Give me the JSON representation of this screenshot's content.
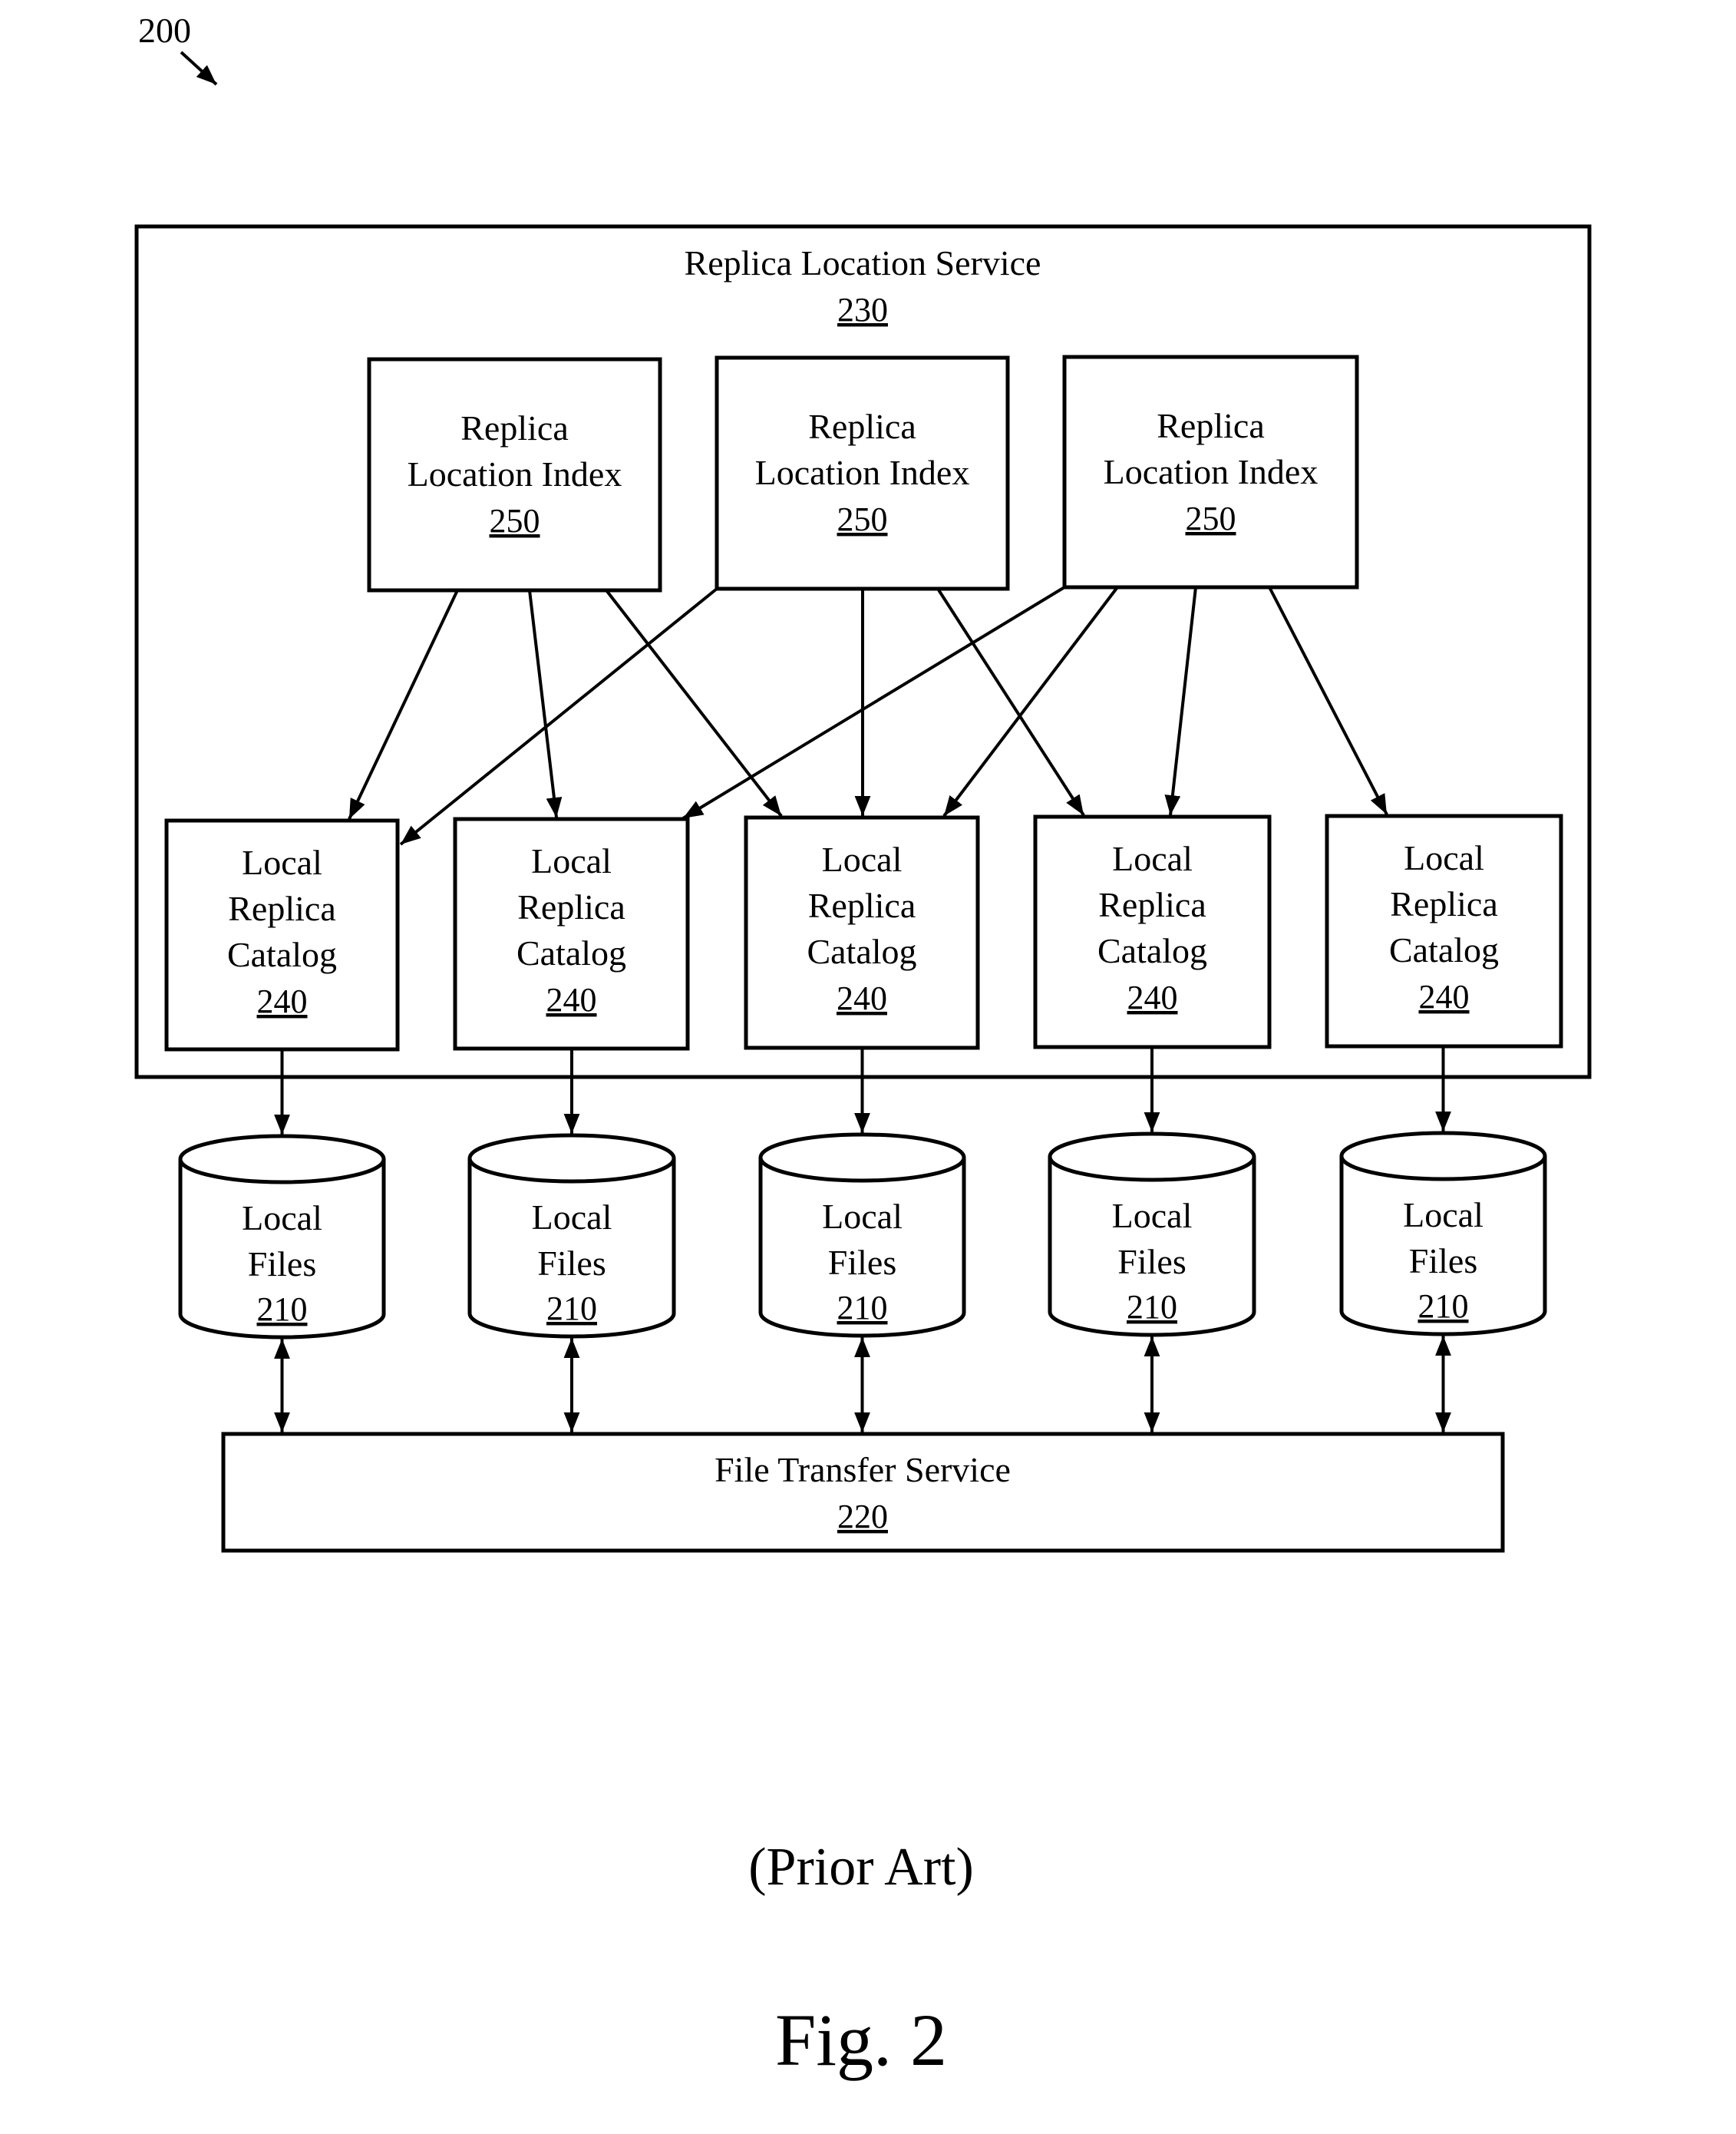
{
  "figure": {
    "ref_number": "200",
    "caption": "(Prior Art)",
    "label": "Fig. 2"
  },
  "replica_location_service": {
    "title": "Replica Location Service",
    "ref": "230"
  },
  "replica_location_indexes": [
    {
      "lines": [
        "Replica",
        "Location Index"
      ],
      "ref": "250"
    },
    {
      "lines": [
        "Replica",
        "Location Index"
      ],
      "ref": "250"
    },
    {
      "lines": [
        "Replica",
        "Location Index"
      ],
      "ref": "250"
    }
  ],
  "local_replica_catalogs": [
    {
      "lines": [
        "Local",
        "Replica",
        "Catalog"
      ],
      "ref": "240"
    },
    {
      "lines": [
        "Local",
        "Replica",
        "Catalog"
      ],
      "ref": "240"
    },
    {
      "lines": [
        "Local",
        "Replica",
        "Catalog"
      ],
      "ref": "240"
    },
    {
      "lines": [
        "Local",
        "Replica",
        "Catalog"
      ],
      "ref": "240"
    },
    {
      "lines": [
        "Local",
        "Replica",
        "Catalog"
      ],
      "ref": "240"
    }
  ],
  "local_files": [
    {
      "lines": [
        "Local",
        "Files"
      ],
      "ref": "210"
    },
    {
      "lines": [
        "Local",
        "Files"
      ],
      "ref": "210"
    },
    {
      "lines": [
        "Local",
        "Files"
      ],
      "ref": "210"
    },
    {
      "lines": [
        "Local",
        "Files"
      ],
      "ref": "210"
    },
    {
      "lines": [
        "Local",
        "Files"
      ],
      "ref": "210"
    }
  ],
  "file_transfer_service": {
    "title": "File Transfer Service",
    "ref": "220"
  },
  "connections": {
    "rli_to_lrc": [
      {
        "from_rli": 0,
        "to_lrc": 0
      },
      {
        "from_rli": 0,
        "to_lrc": 1
      },
      {
        "from_rli": 0,
        "to_lrc": 2
      },
      {
        "from_rli": 1,
        "to_lrc": 0
      },
      {
        "from_rli": 1,
        "to_lrc": 2
      },
      {
        "from_rli": 1,
        "to_lrc": 3
      },
      {
        "from_rli": 2,
        "to_lrc": 1
      },
      {
        "from_rli": 2,
        "to_lrc": 2
      },
      {
        "from_rli": 2,
        "to_lrc": 3
      },
      {
        "from_rli": 2,
        "to_lrc": 4
      }
    ],
    "lrc_to_files": "one-way",
    "files_to_fts": "bidirectional"
  }
}
